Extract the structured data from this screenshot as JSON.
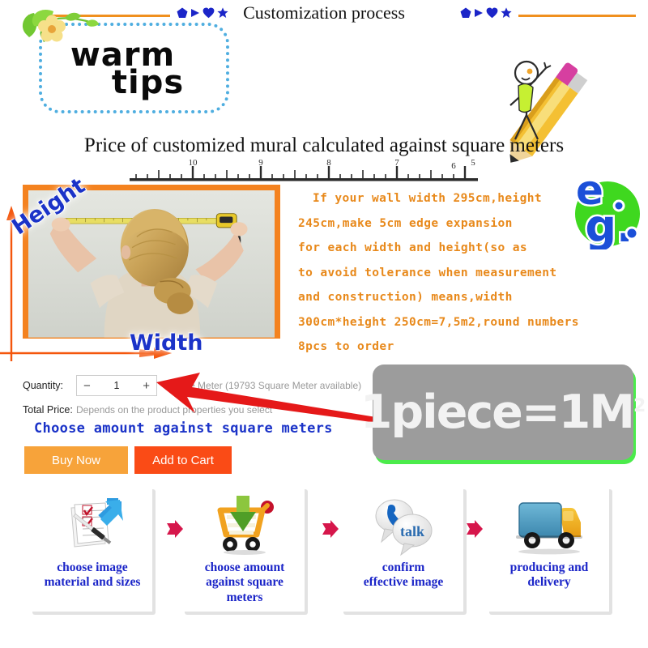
{
  "header": {
    "title": "Customization process",
    "deco_icons": [
      "pentagon-icon",
      "triangle-icon",
      "heart-icon",
      "star-icon"
    ],
    "rule_color": "#F0901E"
  },
  "tips": {
    "line1": "warm",
    "line2": "tips",
    "border_color": "#4FAEE0"
  },
  "price_heading": "Price of customized mural calculated against square meters",
  "ruler": {
    "ticks": [
      "10",
      "9",
      "8",
      "7",
      "6",
      "5"
    ]
  },
  "photo": {
    "height_label": "Height",
    "width_label": "Width",
    "label_color": "#1B33C8",
    "frame_color": "#F4821F"
  },
  "instructions": {
    "color": "#E8891B",
    "lines": [
      "If your wall width 295cm,height",
      "245cm,make 5cm edge expansion",
      "for each width and height(so as",
      "to avoid tolerance when measurement",
      "and construction) means,width",
      "300cm*height 250cm=7,5m2,round numbers",
      "8pcs to order"
    ]
  },
  "eg_badge": {
    "top": "e",
    "bottom": "g.",
    "circle_color": "#3FD81F",
    "letter_color": "#1B4FD8"
  },
  "quantity": {
    "label": "Quantity:",
    "minus": "−",
    "value": "1",
    "plus": "+",
    "unit": "Square Meter (19793 Square Meter available)"
  },
  "total_price": {
    "label": "Total Price:",
    "value": "Depends on the product properties you select"
  },
  "choose_caption": "Choose amount against square meters",
  "buttons": {
    "buy_now": "Buy Now",
    "buy_now_color": "#F7A33A",
    "add_to_cart": "Add to Cart",
    "add_to_cart_color": "#FA4B16"
  },
  "piece_box": {
    "text": "1piece=1M",
    "superscript": "2",
    "box_color": "#9C9C9C",
    "shadow_color": "#4BEB4B"
  },
  "process": {
    "arrow_color": "#D6164B",
    "label_color": "#1B25C8",
    "steps": [
      {
        "icon": "document-checklist-icon",
        "label": "choose image\nmaterial and sizes"
      },
      {
        "icon": "shopping-cart-download-icon",
        "label": "choose amount\nagainst square\nmeters"
      },
      {
        "icon": "talk-bubble-phone-icon",
        "label": "confirm\neffective image"
      },
      {
        "icon": "delivery-truck-icon",
        "label": "producing and\ndelivery"
      }
    ]
  }
}
